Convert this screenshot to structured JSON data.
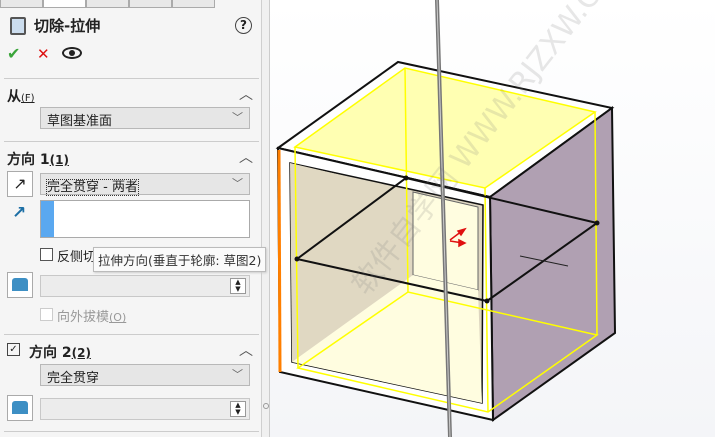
{
  "feature": {
    "title": "切除-拉伸",
    "help": "?"
  },
  "actions": {
    "ok": "✔",
    "cancel": "✕"
  },
  "from": {
    "label": "从",
    "mnemonic": "(F)",
    "value": "草图基准面"
  },
  "direction1": {
    "label": "方向 1",
    "mnemonic": "(1)",
    "end_condition": "完全贯穿 - 两者",
    "flip_side": "反侧切除",
    "draft_outward": "向外拔模",
    "draft_mnemonic": "(O)"
  },
  "tooltip": "拉伸方向(垂直于轮廓: 草图2)",
  "direction2": {
    "label": "方向 2",
    "mnemonic": "(2)",
    "checked": true,
    "end_condition": "完全贯穿"
  },
  "watermark": "软件自学网 WWW.RJZXW.COM",
  "colors": {
    "accent": "#ff7f00",
    "sketch_yellow": "#ffff00",
    "side_face": "#b0a0b2"
  }
}
